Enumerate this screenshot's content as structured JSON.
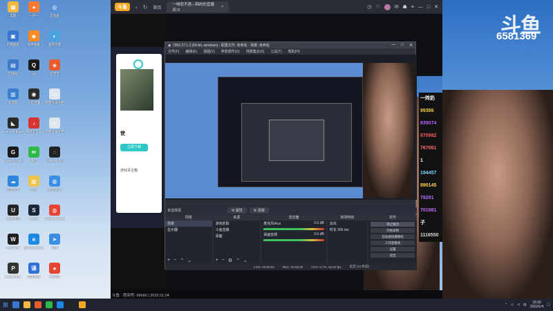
{
  "desktop": {
    "icons": [
      {
        "label": "电脑",
        "color": "#f4b942",
        "glyph": "▦"
      },
      {
        "label": "一对一",
        "color": "#ff7a2f",
        "glyph": "●"
      },
      {
        "label": "启动器",
        "color": "#5a8fd8",
        "glyph": "◎"
      },
      {
        "label": "控制面板",
        "color": "#3a78d0",
        "glyph": "▣"
      },
      {
        "label": "软件管家",
        "color": "#ff8a1e",
        "glyph": "◆"
      },
      {
        "label": "宽带连接",
        "color": "#4aa3e0",
        "glyph": "◐"
      },
      {
        "label": "回收站",
        "color": "#3d79cc",
        "glyph": "▤"
      },
      {
        "label": "QQ",
        "color": "#1a1a1a",
        "glyph": "Q"
      },
      {
        "label": "应用宝",
        "color": "#e85d2f",
        "glyph": "◈"
      },
      {
        "label": "此电脑",
        "color": "#3a7fd0",
        "glyph": "▥"
      },
      {
        "label": "斗鱼直播",
        "color": "#2d2d2d",
        "glyph": "◉"
      },
      {
        "label": "新建文本文档",
        "color": "#dfe6ef",
        "glyph": "▭"
      },
      {
        "label": "GeForce Experience",
        "color": "#2b2b2b",
        "glyph": "◣"
      },
      {
        "label": "网易云音乐",
        "color": "#d9332f",
        "glyph": "♪"
      },
      {
        "label": "新建文本文档",
        "color": "#dfe6ef",
        "glyph": "▭"
      },
      {
        "label": "Logitech G HUB",
        "color": "#1a1a1a",
        "glyph": "G"
      },
      {
        "label": "微信",
        "color": "#2fb847",
        "glyph": "✉"
      },
      {
        "label": "OBS Studio",
        "color": "#222",
        "glyph": "◌"
      },
      {
        "label": "百度网盘",
        "color": "#2e86de",
        "glyph": "☁"
      },
      {
        "label": "照片",
        "color": "#f0c24a",
        "glyph": "▧"
      },
      {
        "label": "腾讯会议",
        "color": "#3a8ee6",
        "glyph": "◍"
      },
      {
        "label": "UU加速器",
        "color": "#242424",
        "glyph": "U"
      },
      {
        "label": "Steam",
        "color": "#1b2838",
        "glyph": "S"
      },
      {
        "label": "Google Chrome",
        "color": "#e94235",
        "glyph": "◍"
      },
      {
        "label": "WeGame",
        "color": "#1f1f1f",
        "glyph": "W"
      },
      {
        "label": "Microsoft Edge",
        "color": "#1e88e5",
        "glyph": "e"
      },
      {
        "label": "迅雷",
        "color": "#3a8ee6",
        "glyph": "➤"
      },
      {
        "label": "PowerToys",
        "color": "#333",
        "glyph": "P"
      },
      {
        "label": "百度翻译",
        "color": "#2f6fd8",
        "glyph": "译"
      },
      {
        "label": "EV录屏",
        "color": "#e6452f",
        "glyph": "●"
      }
    ]
  },
  "wallpaper": {
    "logo": "斗鱼",
    "room_number": "6581369"
  },
  "browser": {
    "logo": "斗鱼",
    "back": "‹",
    "refresh": "↻",
    "home_tab": "首页",
    "active_tab": "一响而不遇—韩的的直播间 D",
    "tab_close": "×",
    "footer": "斗鱼 · 房间号: 66666 | 2022.01.04"
  },
  "promo": {
    "title_fragment": "使",
    "button": "立即下载",
    "subtitle": "游戏百宝箱",
    "sub2": "● 斗鱼直播"
  },
  "obs": {
    "title": "OBS 27.1.3 (64-bit, windows) - 配置文件: 未命名 - 场景: 未命名",
    "menu": [
      "文件(F)",
      "编辑(E)",
      "视图(V)",
      "停靠部件(D)",
      "场景集合(S)",
      "工具(T)",
      "帮助(H)"
    ],
    "source_label": "未选择源",
    "props_btn": "⚙ 属性",
    "filters_btn": "⚙ 滤镜",
    "docks": {
      "scenes": {
        "title": "场景",
        "items": [
          "场景",
          "显示器"
        ]
      },
      "sources": {
        "title": "来源",
        "items": [
          "游戏抓取",
          "斗鱼直播",
          "桌面"
        ]
      },
      "mixer": {
        "title": "混音器",
        "channels": [
          {
            "name": "麦克风/Aux",
            "db": "0.0 dB"
          },
          {
            "name": "桌面音频",
            "db": "0.0 dB"
          }
        ]
      },
      "transitions": {
        "title": "转场特效",
        "type": "淡出",
        "duration_label": "时长",
        "duration": "300 ms"
      },
      "controls": {
        "title": "控件",
        "buttons": [
          "停止推流",
          "开始录制",
          "启动虚拟摄像机",
          "工作室模式",
          "设置",
          "退出"
        ]
      }
    },
    "status": {
      "live": "LIVE: 00:00:00",
      "rec": "REC: 00:00:00",
      "cpu": "CPU: 0.7%, 60.00 fps",
      "lag": "延迟 (10 秒前)"
    }
  },
  "chat_numbers": [
    {
      "text": "一阵奶",
      "color": "#fff"
    },
    {
      "text": "99386",
      "color": "#f3d03a"
    },
    {
      "text": "839074",
      "color": "#b560ff"
    },
    {
      "text": "875982",
      "color": "#ff5a5a"
    },
    {
      "text": "767061",
      "color": "#ff6b6b"
    },
    {
      "text": "1",
      "color": "#fff"
    },
    {
      "text": "194457",
      "color": "#7bd3ff"
    },
    {
      "text": "890145",
      "color": "#ffd24a"
    },
    {
      "text": "78291",
      "color": "#b26bff"
    },
    {
      "text": "701981",
      "color": "#c46bff"
    },
    {
      "text": "子",
      "color": "#fff"
    },
    {
      "text": "1116550",
      "color": "#ddd"
    }
  ],
  "taskbar": {
    "start": "⊞",
    "clock_time": "18:30",
    "clock_date": "2022/1/4",
    "lang": "中"
  }
}
